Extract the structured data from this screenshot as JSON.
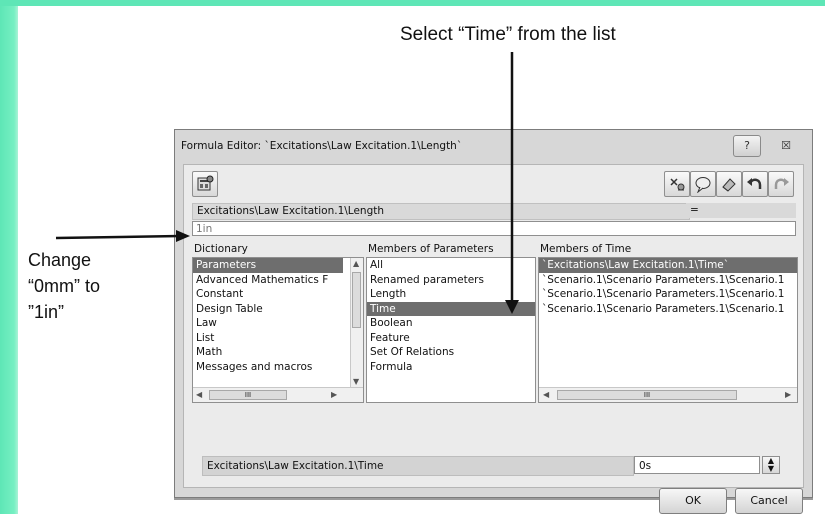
{
  "annotations": {
    "top_instruction": "Select “Time” from the list",
    "left_instruction_lines": [
      "Change",
      "“0mm” to",
      "”1in”"
    ]
  },
  "dialog": {
    "title": "Formula Editor: `Excitations\\Law Excitation.1\\Length`",
    "help_label": "?",
    "close_label": "☒",
    "toolbar_icons": [
      "formula-params-icon",
      "debug-icon",
      "comment-icon",
      "eraser-icon",
      "undo-icon",
      "redo-icon"
    ],
    "path": "Excitations\\Law Excitation.1\\Length",
    "equals": "=",
    "formula_value": "1in",
    "dictionary": {
      "header": "Dictionary",
      "items": [
        "Parameters",
        "Advanced Mathematics F",
        "Constant",
        "Design Table",
        "Law",
        "List",
        "Math",
        "Messages and macros"
      ],
      "selected_index": 0
    },
    "members_of_parameters": {
      "header": "Members of Parameters",
      "items": [
        "All",
        "Renamed parameters",
        "Length",
        "Time",
        "Boolean",
        "Feature",
        "Set Of Relations",
        "Formula"
      ],
      "selected_index": 3
    },
    "members_of_time": {
      "header": "Members of Time",
      "items": [
        "`Excitations\\Law Excitation.1\\Time`",
        "`Scenario.1\\Scenario Parameters.1\\Scenario.1",
        "`Scenario.1\\Scenario Parameters.1\\Scenario.1",
        "`Scenario.1\\Scenario Parameters.1\\Scenario.1"
      ],
      "selected_index": 0
    },
    "bottom_path": "Excitations\\Law Excitation.1\\Time",
    "bottom_value": "0s",
    "ok_label": "OK",
    "cancel_label": "Cancel",
    "scroll_glyph": "III"
  }
}
